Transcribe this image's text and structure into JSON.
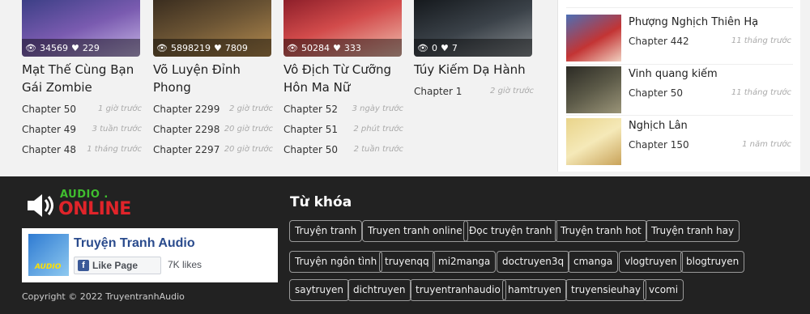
{
  "cards": [
    {
      "title": "Mạt Thế Cùng Bạn Gái Zombie",
      "views": "34569",
      "likes": "229",
      "chapters": [
        {
          "label": "Chapter 50",
          "time": "1 giờ trước"
        },
        {
          "label": "Chapter 49",
          "time": "3 tuần trước"
        },
        {
          "label": "Chapter 48",
          "time": "1 tháng trước"
        }
      ]
    },
    {
      "title": "Võ Luyện Đỉnh Phong",
      "views": "5898219",
      "likes": "7809",
      "chapters": [
        {
          "label": "Chapter 2299",
          "time": "2 giờ trước"
        },
        {
          "label": "Chapter 2298",
          "time": "20 giờ trước"
        },
        {
          "label": "Chapter 2297",
          "time": "20 giờ trước"
        }
      ]
    },
    {
      "title": "Vô Địch Từ Cưỡng Hôn Ma Nữ",
      "views": "50284",
      "likes": "333",
      "chapters": [
        {
          "label": "Chapter 52",
          "time": "3 ngày trước"
        },
        {
          "label": "Chapter 51",
          "time": "2 phút trước"
        },
        {
          "label": "Chapter 50",
          "time": "2 tuần trước"
        }
      ]
    },
    {
      "title": "Túy Kiếm Dạ Hành",
      "views": "0",
      "likes": "7",
      "chapters": [
        {
          "label": "Chapter 1",
          "time": "2 giờ trước"
        }
      ]
    }
  ],
  "sidebar": [
    {
      "name": "Phượng Nghịch Thiên Hạ",
      "chapter": "Chapter 442",
      "time": "11 tháng trước"
    },
    {
      "name": "Vinh quang kiếm",
      "chapter": "Chapter 50",
      "time": "11 tháng trước"
    },
    {
      "name": "Nghịch Lân",
      "chapter": "Chapter 150",
      "time": "1 năm trước"
    }
  ],
  "footer": {
    "logo_top": "AUDIO .",
    "logo_bottom": "ONLINE",
    "fb_page_name": "Truyện Tranh Audio",
    "fb_pic_text": "AUDIO",
    "fb_like_label": "Like Page",
    "fb_like_count": "7K likes",
    "copyright": "Copyright © 2022 TruyentranhAudio",
    "keywords_title": "Từ khóa",
    "keywords": [
      "Truyện tranh",
      "Truyen tranh online",
      "Đọc truyện tranh",
      "Truyện tranh hot",
      "Truyện tranh hay",
      "Truyện ngôn tình",
      "truyenqq",
      "mi2manga",
      "doctruyen3q",
      "cmanga",
      "vlogtruyen",
      "blogtruyen",
      "saytruyen",
      "dichtruyen",
      "truyentranhaudio",
      "hamtruyen",
      "truyensieuhay",
      "vcomi"
    ]
  },
  "colors": {
    "footer_bg": "#222222",
    "accent_green": "#3fbf2f",
    "accent_red": "#e0242a",
    "fb_blue": "#3b5998"
  },
  "icons": {
    "views": "eye-icon",
    "likes": "heart-icon",
    "speaker": "speaker-icon",
    "facebook": "facebook-icon"
  }
}
